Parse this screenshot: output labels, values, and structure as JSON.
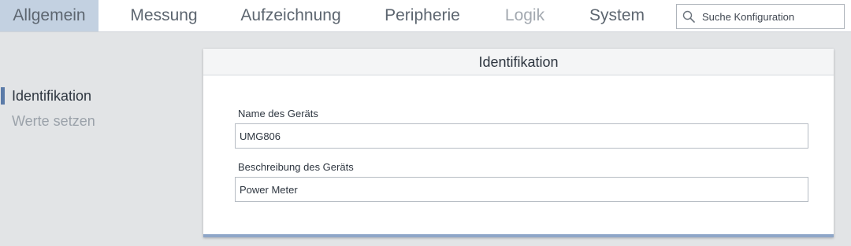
{
  "tabs": {
    "allgemein": "Allgemein",
    "messung": "Messung",
    "aufzeichnung": "Aufzeichnung",
    "peripherie": "Peripherie",
    "logik": "Logik",
    "system": "System"
  },
  "search": {
    "placeholder": "Suche Konfiguration",
    "icon": "search-icon"
  },
  "sidebar": {
    "items": [
      {
        "label": "Identifikation",
        "active": true
      },
      {
        "label": "Werte setzen",
        "active": false
      }
    ]
  },
  "panel": {
    "title": "Identifikation",
    "fields": {
      "name_label": "Name des Geräts",
      "name_value": "UMG806",
      "description_label": "Beschreibung des Geräts",
      "description_value": "Power Meter"
    }
  },
  "colors": {
    "active_tab": "#c3d1e1",
    "accent": "#5b7ba8",
    "panel_footer": "#8ea6c8",
    "background": "#e2e4e6"
  }
}
